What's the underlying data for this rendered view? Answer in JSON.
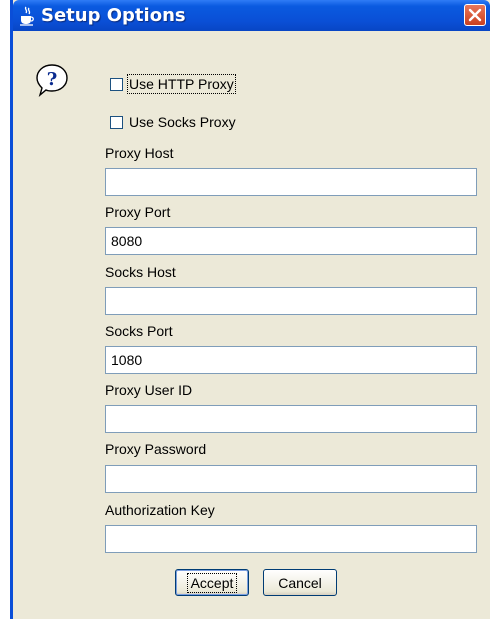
{
  "window": {
    "title": "Setup Options",
    "icon": "java-cup-icon",
    "close_icon": "close-icon"
  },
  "dialog": {
    "message_icon": "question-icon",
    "checkboxes": {
      "use_http_proxy": {
        "label": "Use HTTP Proxy",
        "checked": false
      },
      "use_socks_proxy": {
        "label": "Use Socks Proxy",
        "checked": false
      }
    },
    "fields": {
      "proxy_host": {
        "label": "Proxy Host",
        "value": ""
      },
      "proxy_port": {
        "label": "Proxy Port",
        "value": "8080"
      },
      "socks_host": {
        "label": "Socks Host",
        "value": ""
      },
      "socks_port": {
        "label": "Socks Port",
        "value": "1080"
      },
      "proxy_user_id": {
        "label": "Proxy User ID",
        "value": ""
      },
      "proxy_password": {
        "label": "Proxy Password",
        "value": ""
      },
      "authorization_key": {
        "label": "Authorization Key",
        "value": ""
      }
    },
    "buttons": {
      "accept": "Accept",
      "cancel": "Cancel"
    }
  },
  "colors": {
    "titlebar": "#0a5ae0",
    "dialog_background": "#ece9d8",
    "close_button": "#c9401f",
    "field_border": "#7f9db9"
  }
}
